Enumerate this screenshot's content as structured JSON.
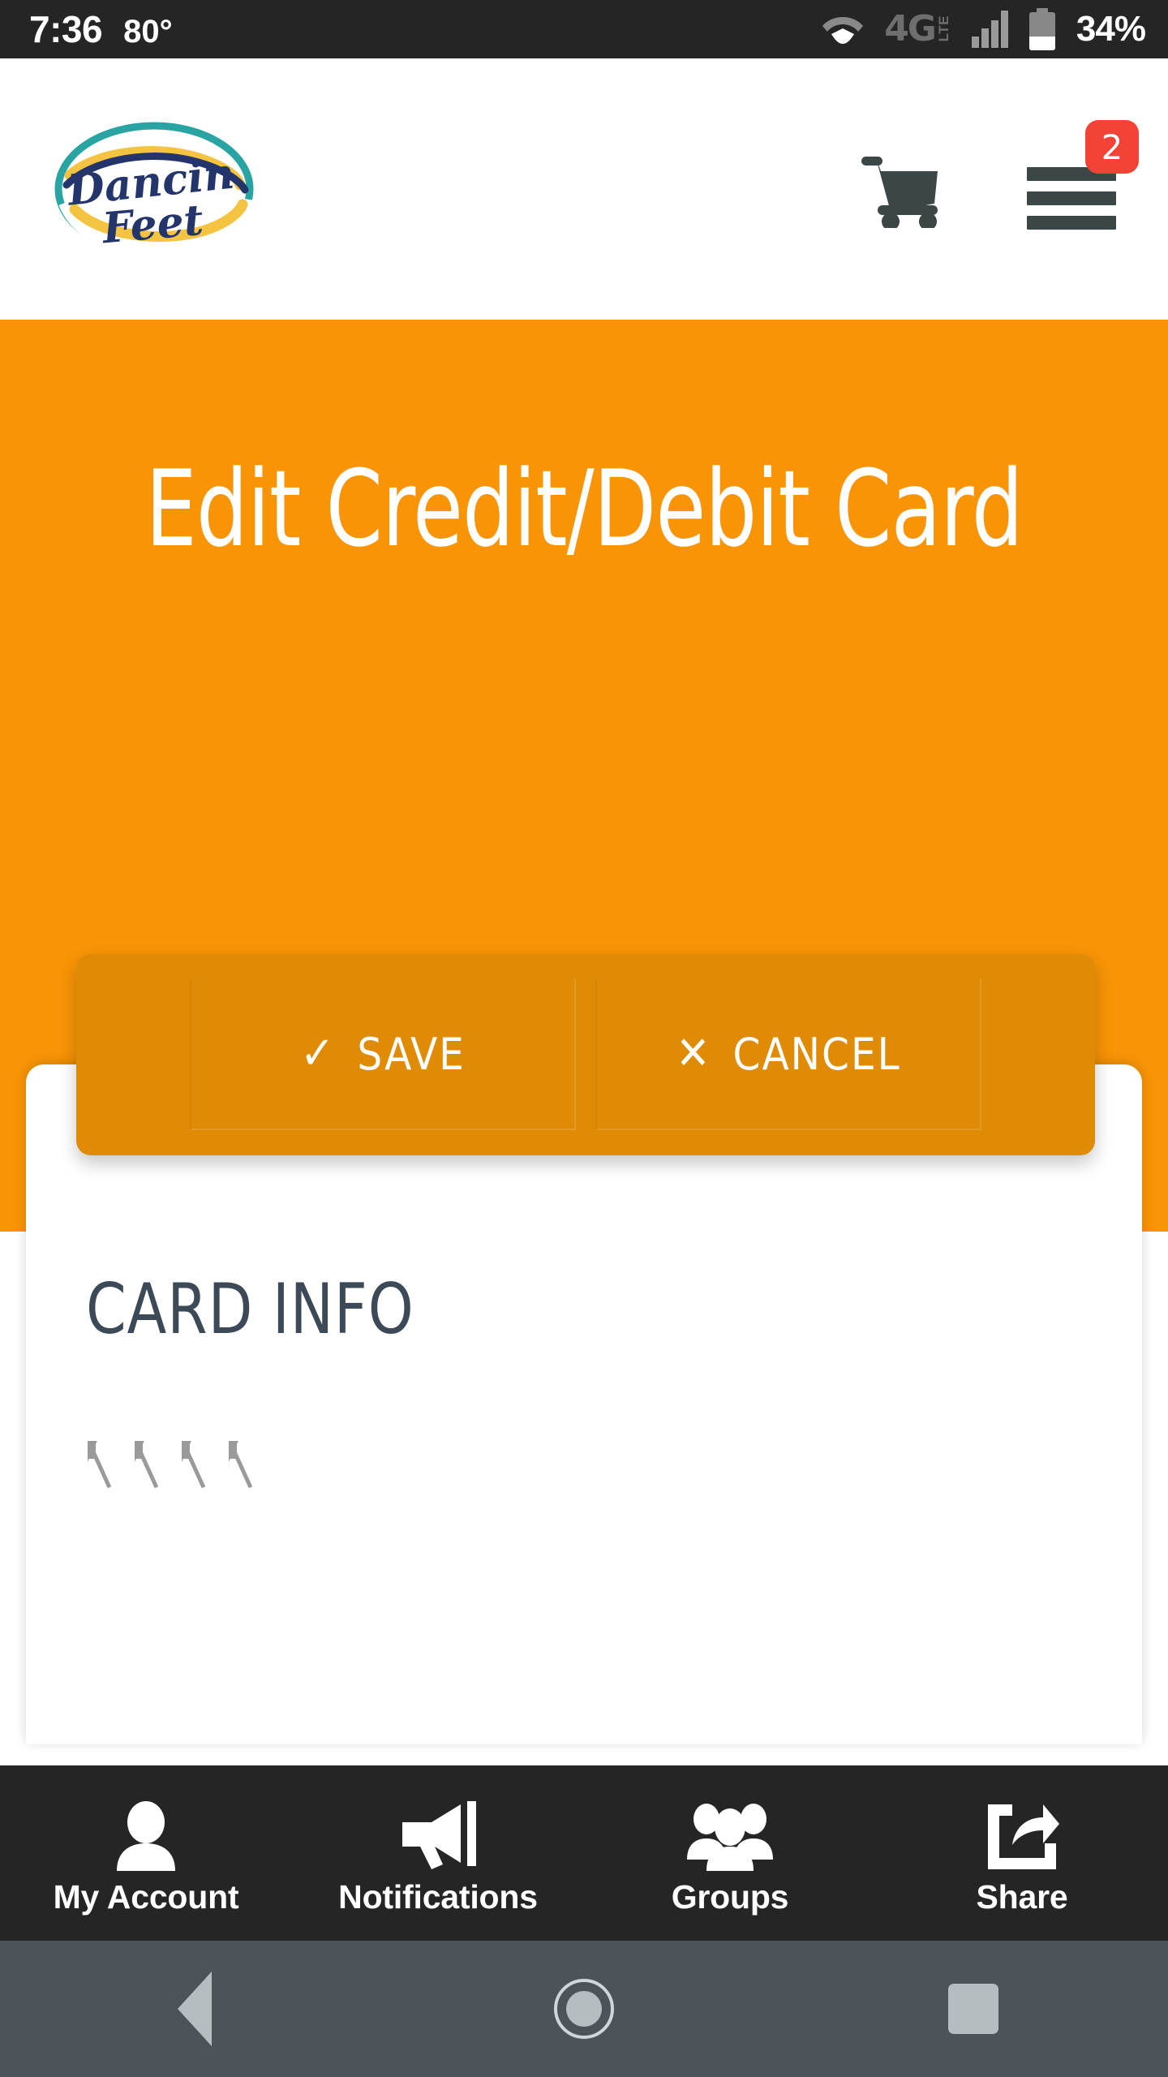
{
  "statusbar": {
    "time": "7:36",
    "temperature": "80°",
    "battery_percent": "34%",
    "network_label": "4G",
    "network_sub": "LTE",
    "icons": [
      "wifi-icon",
      "4g-lte-icon",
      "signal-bars-icon",
      "battery-icon"
    ],
    "background_color": "#252525"
  },
  "appbar": {
    "logo_alt": "Dancin Feet",
    "logo_text_top": "Dancin",
    "logo_text_bottom": "Feet",
    "cart_icon": "shopping-cart-icon",
    "menu_icon": "hamburger-menu-icon",
    "menu_badge_count": "2",
    "badge_color": "#f44336",
    "icon_color": "#3b4747"
  },
  "hero": {
    "title": "Edit Credit/Debit Card",
    "background_color": "#f89406"
  },
  "actions": {
    "panel_color": "#e08b05",
    "save": {
      "label": "SAVE",
      "glyph": "✓",
      "icon_name": "check-icon"
    },
    "cancel": {
      "label": "CANCEL",
      "glyph": "✕",
      "icon_name": "close-x-icon"
    }
  },
  "card_info": {
    "section_title": "CARD INFO",
    "masked_value": "□□□□",
    "tofu_count": 4,
    "title_color": "#3c4a57"
  },
  "tabbar": {
    "background_color": "#252525",
    "items": [
      {
        "label": "My Account",
        "icon": "person-icon"
      },
      {
        "label": "Notifications",
        "icon": "megaphone-icon"
      },
      {
        "label": "Groups",
        "icon": "people-group-icon"
      },
      {
        "label": "Share",
        "icon": "share-arrow-icon"
      }
    ]
  },
  "navbar": {
    "background_color": "#4c545a",
    "back_label": "Back",
    "home_label": "Home",
    "recents_label": "Recents"
  }
}
